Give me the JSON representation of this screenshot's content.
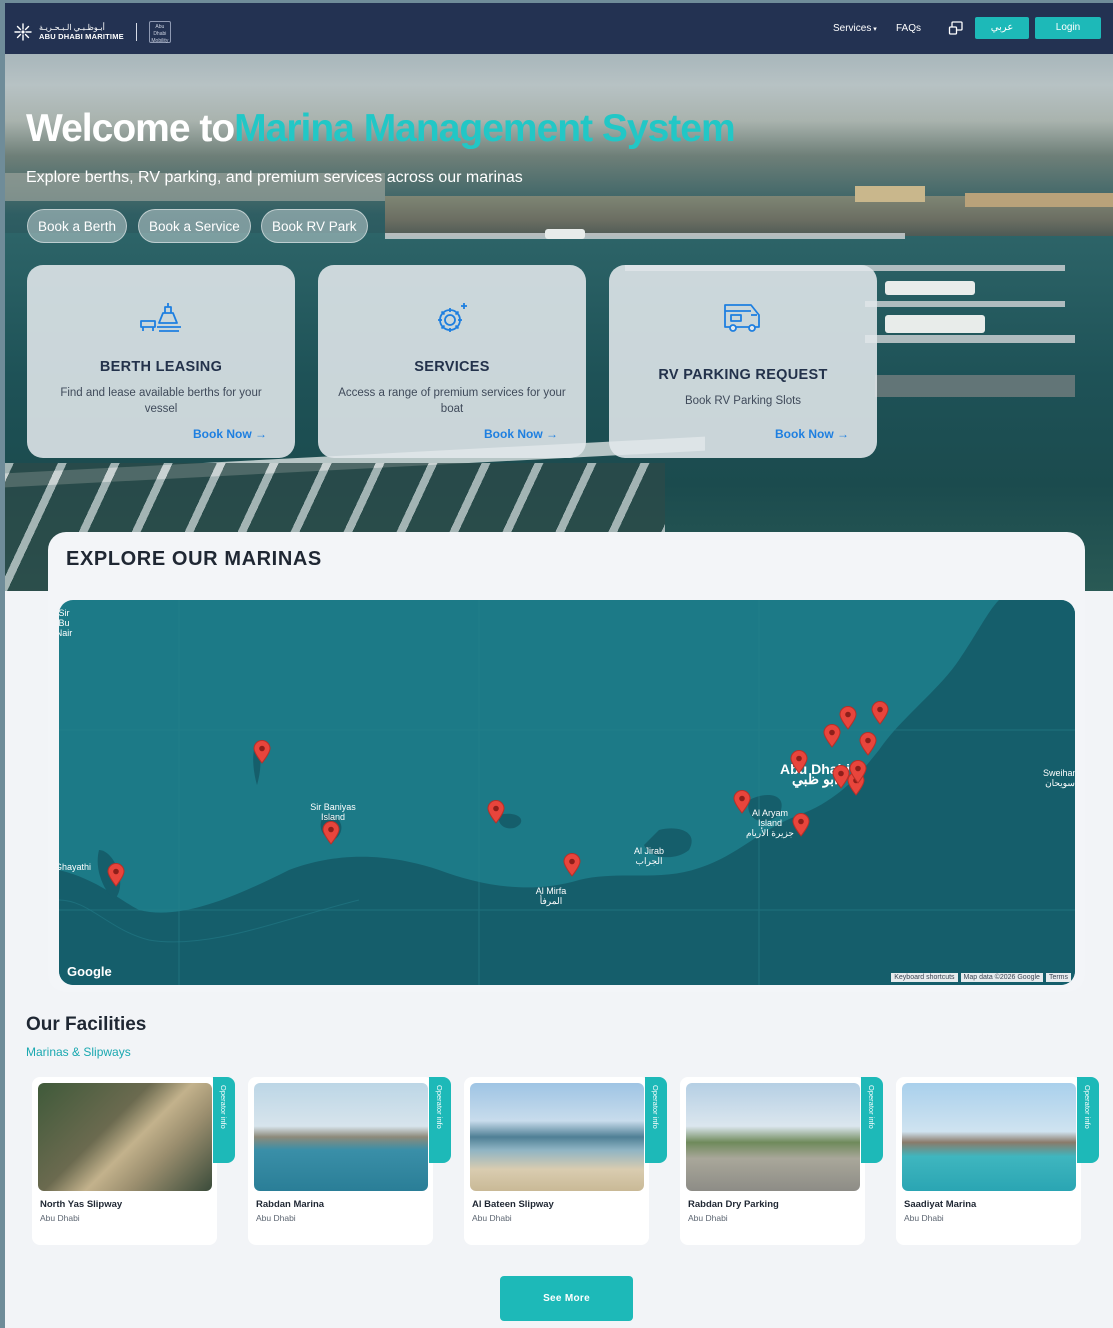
{
  "nav": {
    "logo_ar": "أبـوظـبـي الـبـحـريـة",
    "logo_en": "ABU DHABI MARITIME",
    "secondary_logo_text": "Abu Dhabi Mobility",
    "services": "Services",
    "faqs": "FAQs",
    "arabic": "عربي",
    "login": "Login"
  },
  "hero": {
    "title_prefix": "Welcome to",
    "title_accent": "Marina Management System",
    "subtitle": "Explore berths, RV parking, and premium services across our marinas",
    "pills": [
      "Book a Berth",
      "Book a Service",
      "Book RV Park"
    ]
  },
  "cards": [
    {
      "title": "BERTH LEASING",
      "desc": "Find and lease available berths for your vessel",
      "cta": "Book Now",
      "icon": "berth-icon"
    },
    {
      "title": "SERVICES",
      "desc": "Access a range of premium services for your boat",
      "cta": "Book Now",
      "icon": "gear-sparkle-icon"
    },
    {
      "title": "RV PARKING REQUEST",
      "desc": "Book RV Parking Slots",
      "cta": "Book Now",
      "icon": "rv-icon"
    }
  ],
  "marinas": {
    "title": "EXPLORE OUR MARINAS",
    "map_labels": {
      "abu_dhabi": "Abu Dhabi",
      "abu_dhabi_ar": "أبو ظبي",
      "sir_baniyas": "Sir Baniyas Island",
      "al_jirab": "Al Jirab",
      "al_jirab_ar": "الجراب",
      "al_mirfa": "Al Mirfa",
      "al_mirfa_ar": "المرفأ",
      "al_aryam": "Al Aryam Island",
      "al_aryam_ar": "جزيرة الأريام",
      "sweihan": "Sweihan",
      "sweihan_ar": "سويحان",
      "edge_left_top": "Sir Bu Nair",
      "edge_left_mid": "Ghayathi"
    },
    "google": "Google",
    "footer": [
      "Keyboard shortcuts",
      "Map data ©2026 Google",
      "Terms"
    ]
  },
  "facilities": {
    "title": "Our Facilities",
    "subtitle": "Marinas & Slipways",
    "tag": "Operator info",
    "items": [
      {
        "name": "North Yas Slipway",
        "location": "Abu Dhabi"
      },
      {
        "name": "Rabdan Marina",
        "location": "Abu Dhabi"
      },
      {
        "name": "Al Bateen Slipway",
        "location": "Abu Dhabi"
      },
      {
        "name": "Rabdan Dry Parking",
        "location": "Abu Dhabi"
      },
      {
        "name": "Saadiyat Marina",
        "location": "Abu Dhabi"
      }
    ],
    "see_more": "See More"
  },
  "colors": {
    "navy": "#233252",
    "teal": "#1db9b8",
    "accent_title": "#22c7c6",
    "link_blue": "#1e7fe0",
    "pin_red": "#e8453c"
  }
}
